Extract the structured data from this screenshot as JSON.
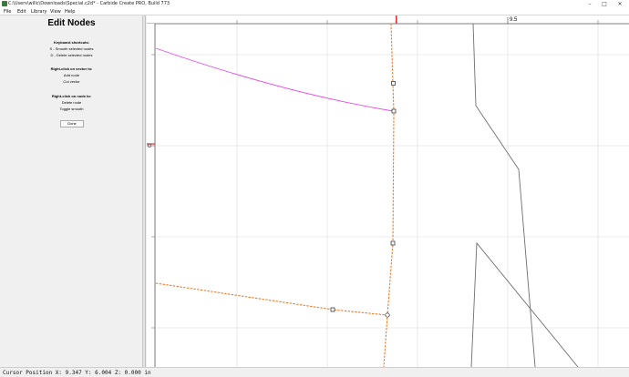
{
  "window": {
    "title": "C:\\Users\\willc\\Downloads\\Special.c2d* - Carbide Create PRO, Build 773",
    "icon": "carbide-app-icon"
  },
  "menu": {
    "items": [
      "File",
      "Edit",
      "Library",
      "View",
      "Help"
    ]
  },
  "panel": {
    "heading": "Edit Nodes",
    "shortcuts_title": "Keyboard shortcuts:",
    "shortcut_smooth": "S - Smooth selected nodes",
    "shortcut_delete": "D - Delete selected nodes",
    "vector_title": "Right-click on vector to:",
    "vector_add": "Add node",
    "vector_cut": "Cut vector",
    "node_title": "Right-click on node to:",
    "node_delete": "Delete node",
    "node_toggle": "Toggle smooth",
    "done_label": "Done"
  },
  "ruler": {
    "label": "9.5"
  },
  "status": {
    "text": "Cursor Position X: 9.347 Y: 6.004 Z: 0.000 in"
  },
  "colors": {
    "orange_path": "#f07a2a",
    "magenta_path": "#e84ae8",
    "grey_path": "#6f6f6f",
    "marker": "#e23030",
    "grid": "#dcdcdc"
  }
}
